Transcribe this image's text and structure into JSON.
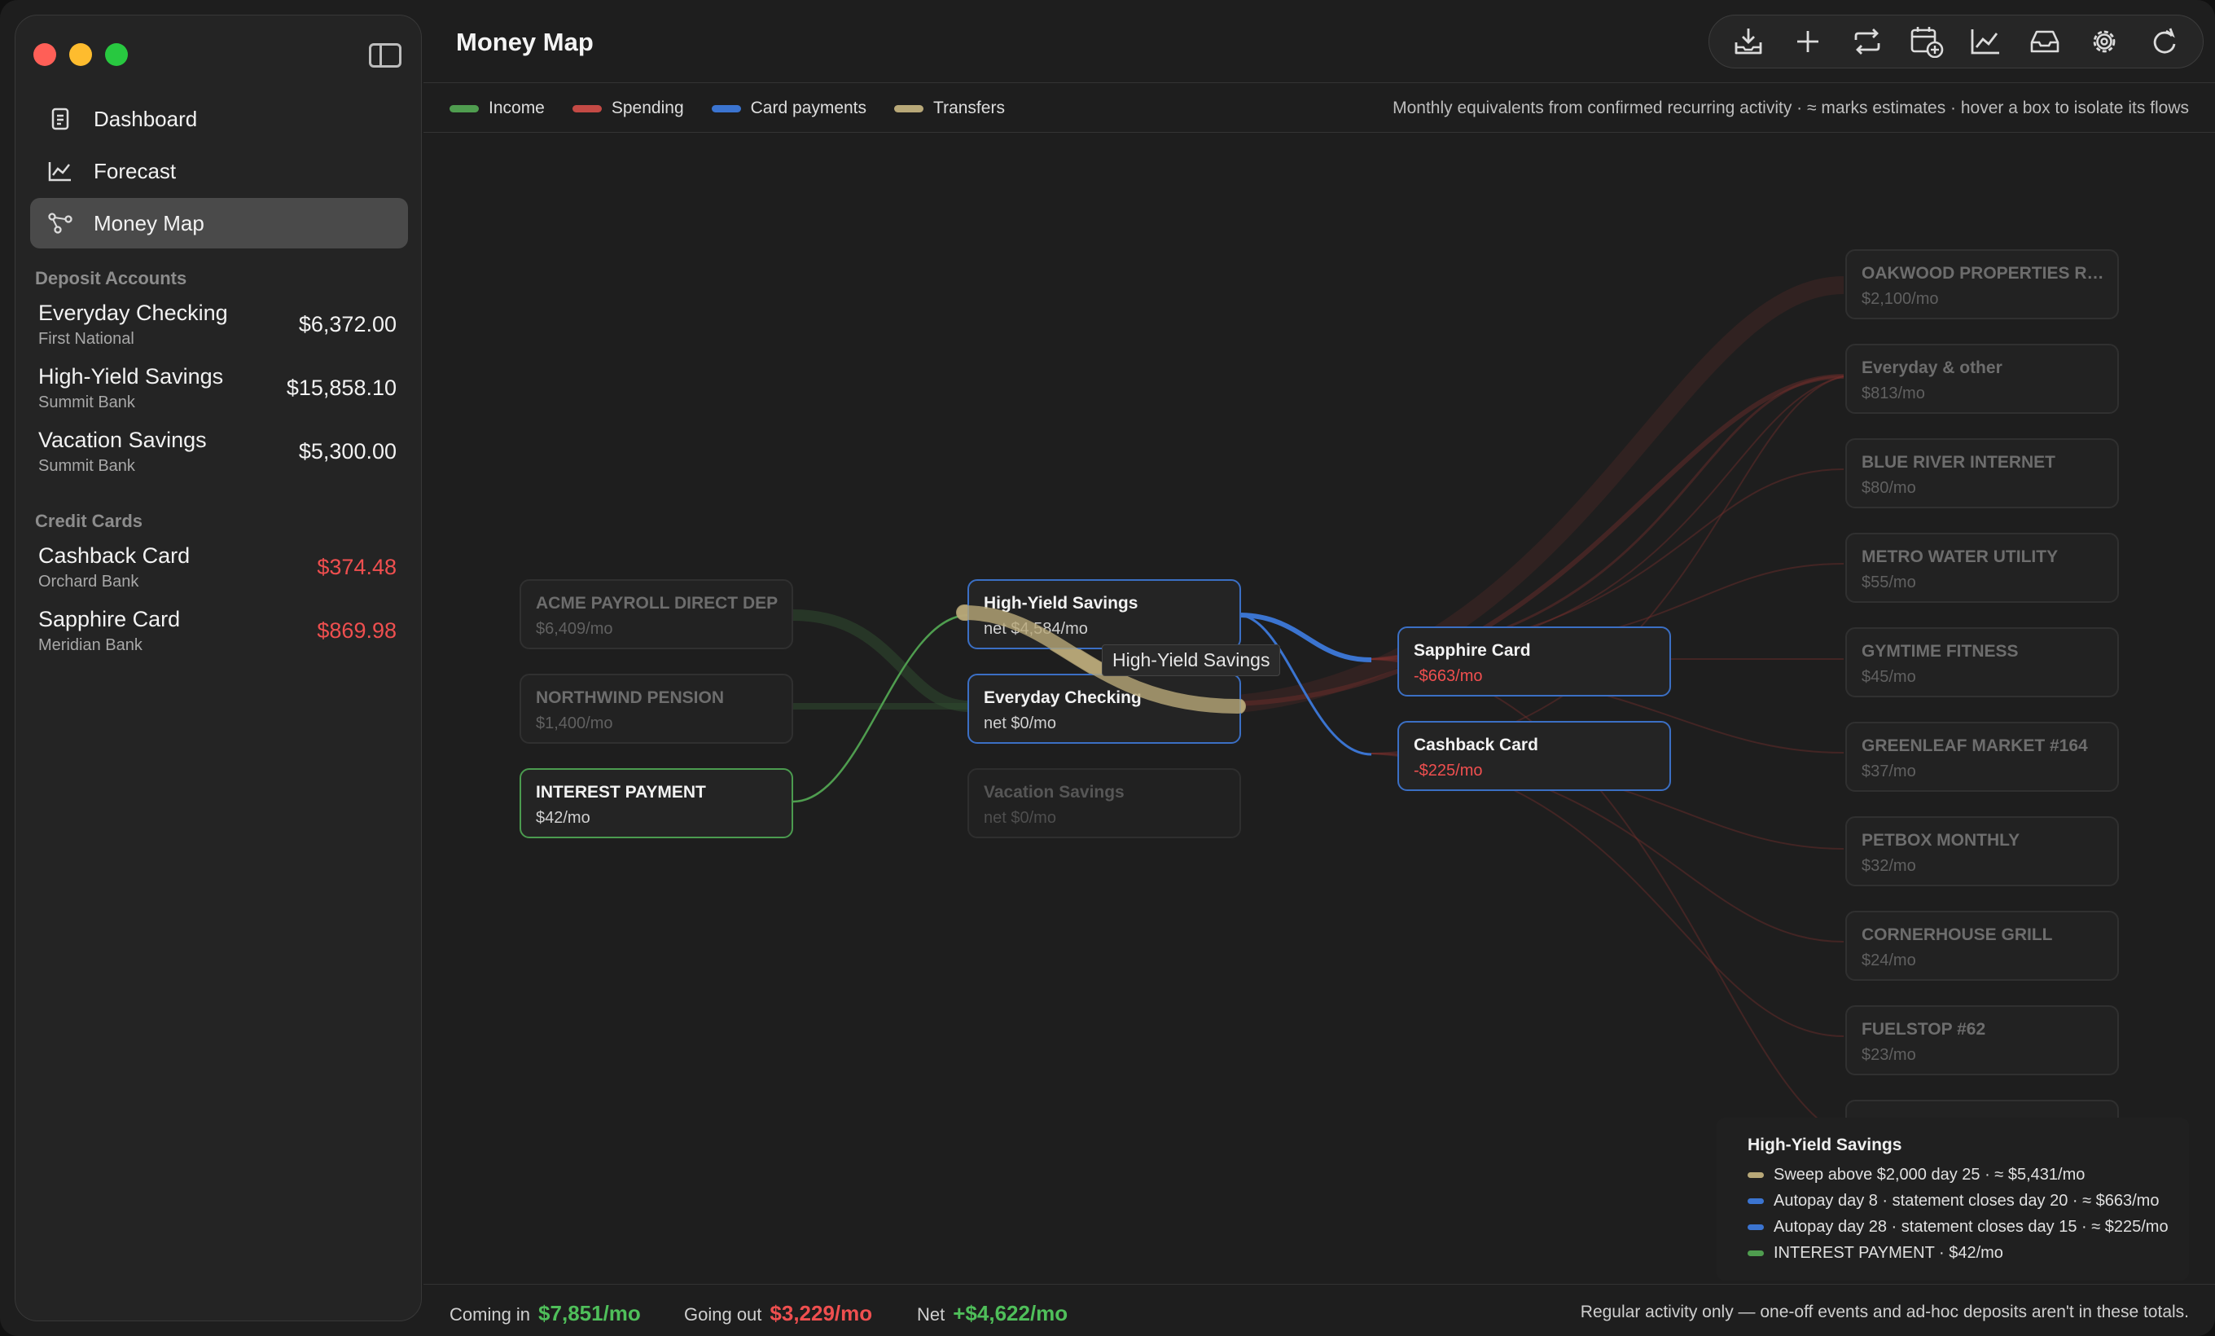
{
  "window": {
    "title": "Money Map"
  },
  "sidebar": {
    "nav": [
      {
        "label": "Dashboard",
        "icon": "document-icon"
      },
      {
        "label": "Forecast",
        "icon": "line-chart-icon"
      },
      {
        "label": "Money Map",
        "icon": "network-icon",
        "active": true
      }
    ],
    "deposit_title": "Deposit Accounts",
    "deposit_accounts": [
      {
        "name": "Everyday Checking",
        "institution": "First National",
        "balance": "$6,372.00"
      },
      {
        "name": "High-Yield Savings",
        "institution": "Summit Bank",
        "balance": "$15,858.10"
      },
      {
        "name": "Vacation Savings",
        "institution": "Summit Bank",
        "balance": "$5,300.00"
      }
    ],
    "credit_title": "Credit Cards",
    "credit_cards": [
      {
        "name": "Cashback Card",
        "institution": "Orchard Bank",
        "balance": "$374.48"
      },
      {
        "name": "Sapphire Card",
        "institution": "Meridian Bank",
        "balance": "$869.98"
      }
    ]
  },
  "toolbar": {
    "buttons": [
      "import-icon",
      "add-icon",
      "transfer-icon",
      "schedule-icon",
      "chart-icon",
      "inbox-icon",
      "settings-icon",
      "refresh-icon"
    ]
  },
  "legend": {
    "items": [
      {
        "label": "Income",
        "color": "#4f9d4f"
      },
      {
        "label": "Spending",
        "color": "#c44a45"
      },
      {
        "label": "Card payments",
        "color": "#3b74d0"
      },
      {
        "label": "Transfers",
        "color": "#b8a878"
      }
    ],
    "note": "Monthly equivalents from confirmed recurring activity · ≈ marks estimates · hover a box to isolate its flows"
  },
  "map": {
    "sources": [
      {
        "label": "ACME PAYROLL DIRECT DEP",
        "amount": "$6,409/mo"
      },
      {
        "label": "NORTHWIND PENSION",
        "amount": "$1,400/mo"
      },
      {
        "label": "INTEREST PAYMENT",
        "amount": "$42/mo"
      }
    ],
    "accounts": [
      {
        "label": "High-Yield Savings",
        "amount": "net $4,584/mo"
      },
      {
        "label": "Everyday Checking",
        "amount": "net $0/mo"
      },
      {
        "label": "Vacation Savings",
        "amount": "net $0/mo"
      }
    ],
    "cards": [
      {
        "label": "Sapphire Card",
        "amount": "-$663/mo"
      },
      {
        "label": "Cashback Card",
        "amount": "-$225/mo"
      }
    ],
    "payees": [
      {
        "label": "OAKWOOD PROPERTIES RE...",
        "amount": "$2,100/mo"
      },
      {
        "label": "Everyday & other",
        "amount": "$813/mo"
      },
      {
        "label": "BLUE RIVER INTERNET",
        "amount": "$80/mo"
      },
      {
        "label": "METRO WATER UTILITY",
        "amount": "$55/mo"
      },
      {
        "label": "GYMTIME FITNESS",
        "amount": "$45/mo"
      },
      {
        "label": "GREENLEAF MARKET #164",
        "amount": "$37/mo"
      },
      {
        "label": "PETBOX MONTHLY",
        "amount": "$32/mo"
      },
      {
        "label": "CORNERHOUSE GRILL",
        "amount": "$24/mo"
      },
      {
        "label": "FUELSTOP #62",
        "amount": "$23/mo"
      }
    ],
    "hover_label": "High-Yield Savings"
  },
  "tooltip": {
    "title": "High-Yield Savings",
    "rows": [
      {
        "text": "Sweep above $2,000 day 25 · ≈ $5,431/mo",
        "color": "#b8a878"
      },
      {
        "text": "Autopay day 8 · statement closes day 20 · ≈ $663/mo",
        "color": "#3b74d0"
      },
      {
        "text": "Autopay day 28 · statement closes day 15 · ≈ $225/mo",
        "color": "#3b74d0"
      },
      {
        "text": "INTEREST PAYMENT · $42/mo",
        "color": "#4f9d4f"
      }
    ]
  },
  "footer": {
    "coming_in_label": "Coming in",
    "coming_in": "$7,851/mo",
    "going_out_label": "Going out",
    "going_out": "$3,229/mo",
    "net_label": "Net",
    "net": "+$4,622/mo",
    "note": "Regular activity only — one-off events and ad-hoc deposits aren't in these totals."
  }
}
